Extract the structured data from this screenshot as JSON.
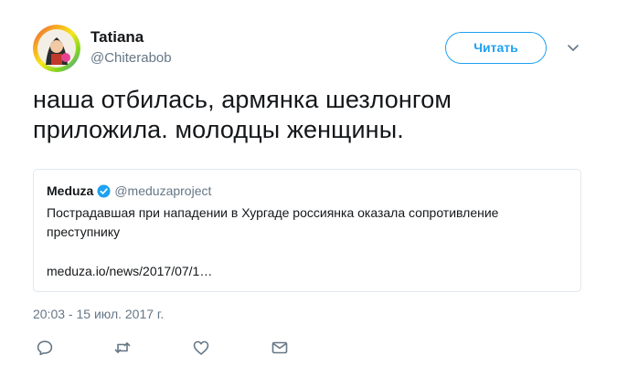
{
  "author": {
    "display_name": "Tatiana",
    "username": "@Chiterabob"
  },
  "follow": {
    "label": "Читать"
  },
  "tweet": {
    "text": "наша отбилась, армянка шезлонгом приложила. молодцы женщины.",
    "timestamp": "20:03 - 15 июл. 2017 г."
  },
  "quoted_tweet": {
    "display_name": "Meduza",
    "username": "@meduzaproject",
    "text": "Пострадавшая при нападении в Хургаде россиянка оказала сопротивление преступнику",
    "link": "meduza.io/news/2017/07/1…"
  },
  "icons": {
    "reply": "reply-icon",
    "retweet": "retweet-icon",
    "like": "heart-icon",
    "dm": "envelope-icon",
    "caret": "chevron-down-icon",
    "verified": "verified-badge-icon"
  },
  "colors": {
    "accent": "#1da1f2",
    "secondary_text": "#657786",
    "primary_text": "#14171a",
    "border": "#e1e8ed"
  }
}
